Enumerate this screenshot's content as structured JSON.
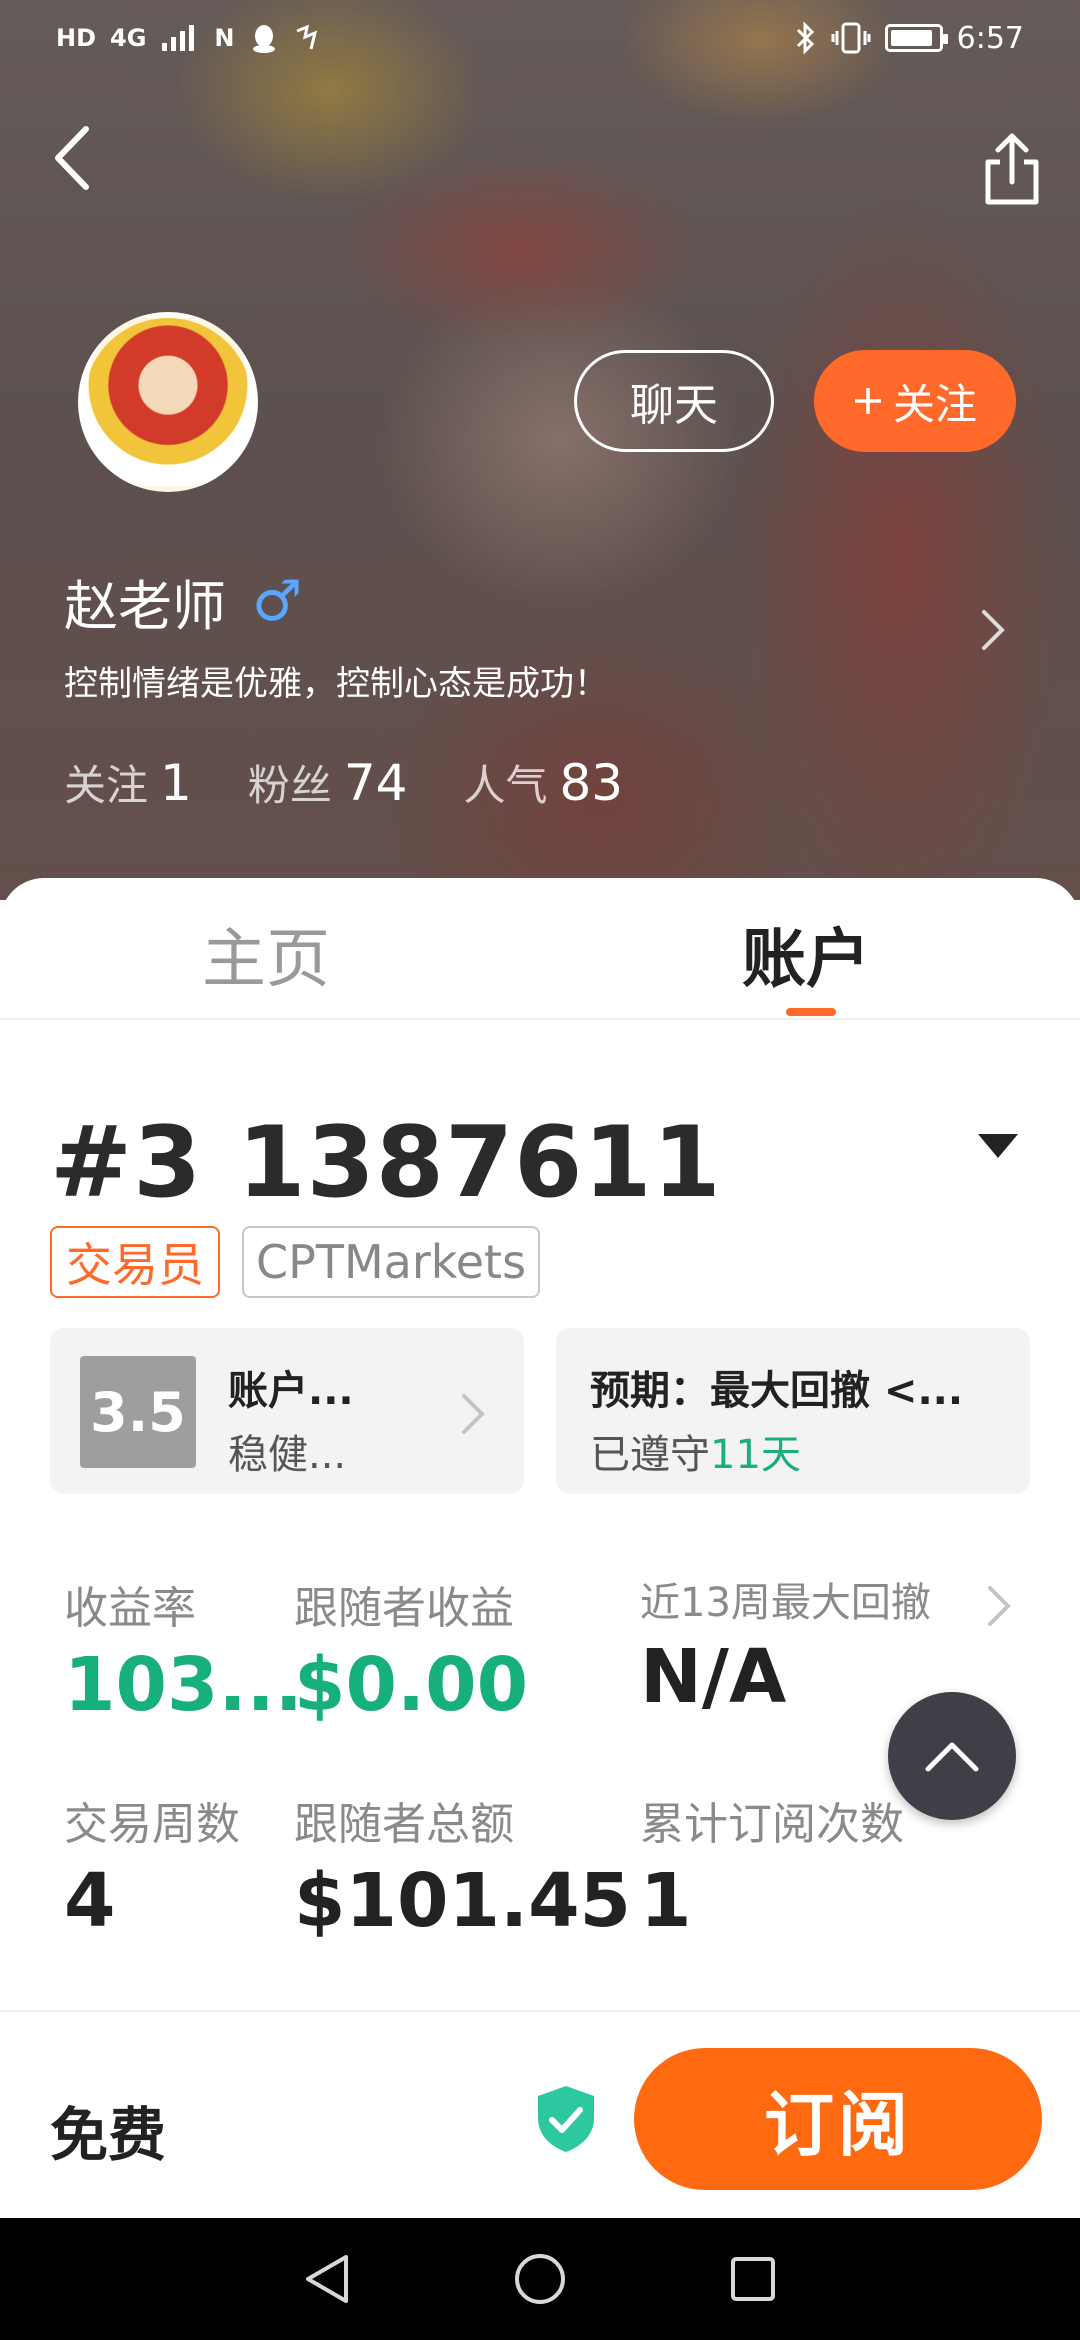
{
  "status_bar": {
    "left_indicators": [
      "HD",
      "4G",
      "N"
    ],
    "time": "6:57"
  },
  "profile": {
    "chat_label": "聊天",
    "follow_label": "关注",
    "name": "赵老师",
    "gender_symbol": "♂",
    "bio": "控制情绪是优雅，控制心态是成功！",
    "stats": [
      {
        "label": "关注",
        "value": "1"
      },
      {
        "label": "粉丝",
        "value": "74"
      },
      {
        "label": "人气",
        "value": "83"
      }
    ]
  },
  "tabs": [
    {
      "label": "主页",
      "active": false
    },
    {
      "label": "账户",
      "active": true
    }
  ],
  "account": {
    "number": "#3 1387611",
    "tag_role": "交易员",
    "tag_broker": "CPTMarkets",
    "score": "3.5",
    "rating_title": "账户...",
    "rating_sub": "稳健...",
    "expectation_title": "预期：最大回撤 <...",
    "expectation_sub_prefix": "已遵守",
    "expectation_days": "11天"
  },
  "metrics": [
    {
      "label": "收益率",
      "value": "103..."
    },
    {
      "label": "跟随者收益",
      "value": "$0.00"
    },
    {
      "label": "近13周最大回撤",
      "value": "N/A"
    },
    {
      "label": "交易周数",
      "value": "4"
    },
    {
      "label": "跟随者总额",
      "value": "$101.45"
    },
    {
      "label": "累计订阅次数",
      "value": "1"
    }
  ],
  "action_bar": {
    "price_label": "免费",
    "subscribe_label": "订阅"
  },
  "colors": {
    "accent_orange": "#ff6a2b",
    "subscribe_orange": "#ff6a10",
    "positive_green": "#17b07a",
    "shield_green": "#2ec8a0"
  }
}
